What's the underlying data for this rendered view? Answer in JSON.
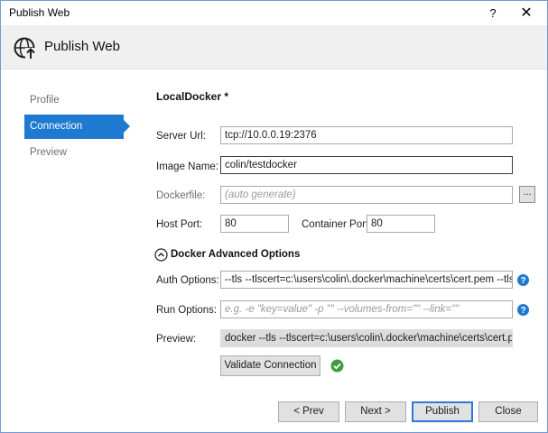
{
  "window": {
    "title": "Publish Web",
    "help_glyph": "?",
    "close_glyph": "✕"
  },
  "header": {
    "title": "Publish Web",
    "icon": "globe-upload-icon"
  },
  "nav": {
    "items": [
      {
        "label": "Profile",
        "active": false
      },
      {
        "label": "Connection",
        "active": true
      },
      {
        "label": "Preview",
        "active": false
      }
    ]
  },
  "form": {
    "section_title": "LocalDocker *",
    "server_url": {
      "label": "Server Url:",
      "value": "tcp://10.0.0.19:2376"
    },
    "image_name": {
      "label": "Image Name:",
      "value": "colin/testdocker"
    },
    "dockerfile": {
      "label": "Dockerfile:",
      "placeholder": "(auto generate)",
      "browse_label": "..."
    },
    "host_port": {
      "label": "Host Port:",
      "value": "80"
    },
    "container_port": {
      "label": "Container Port:",
      "value": "80"
    },
    "advanced": {
      "label": "Docker Advanced Options",
      "expanded": true
    },
    "auth_options": {
      "label": "Auth Options:",
      "value": "--tls --tlscert=c:\\users\\colin\\.docker\\machine\\certs\\cert.pem --tlskey="
    },
    "run_options": {
      "label": "Run Options:",
      "placeholder": "e.g. -e \"key=value\" -p \"\" --volumes-from=\"\" --link=\"\""
    },
    "preview": {
      "label": "Preview:",
      "value": "docker --tls --tlscert=c:\\users\\colin\\.docker\\machine\\certs\\cert.pem --"
    },
    "validate_label": "Validate Connection"
  },
  "footer": {
    "prev_label": "< Prev",
    "next_label": "Next >",
    "publish_label": "Publish",
    "close_label": "Close"
  },
  "colors": {
    "accent": "#1e7ad0",
    "success": "#3c9e3c",
    "help": "#1e7ad0"
  }
}
